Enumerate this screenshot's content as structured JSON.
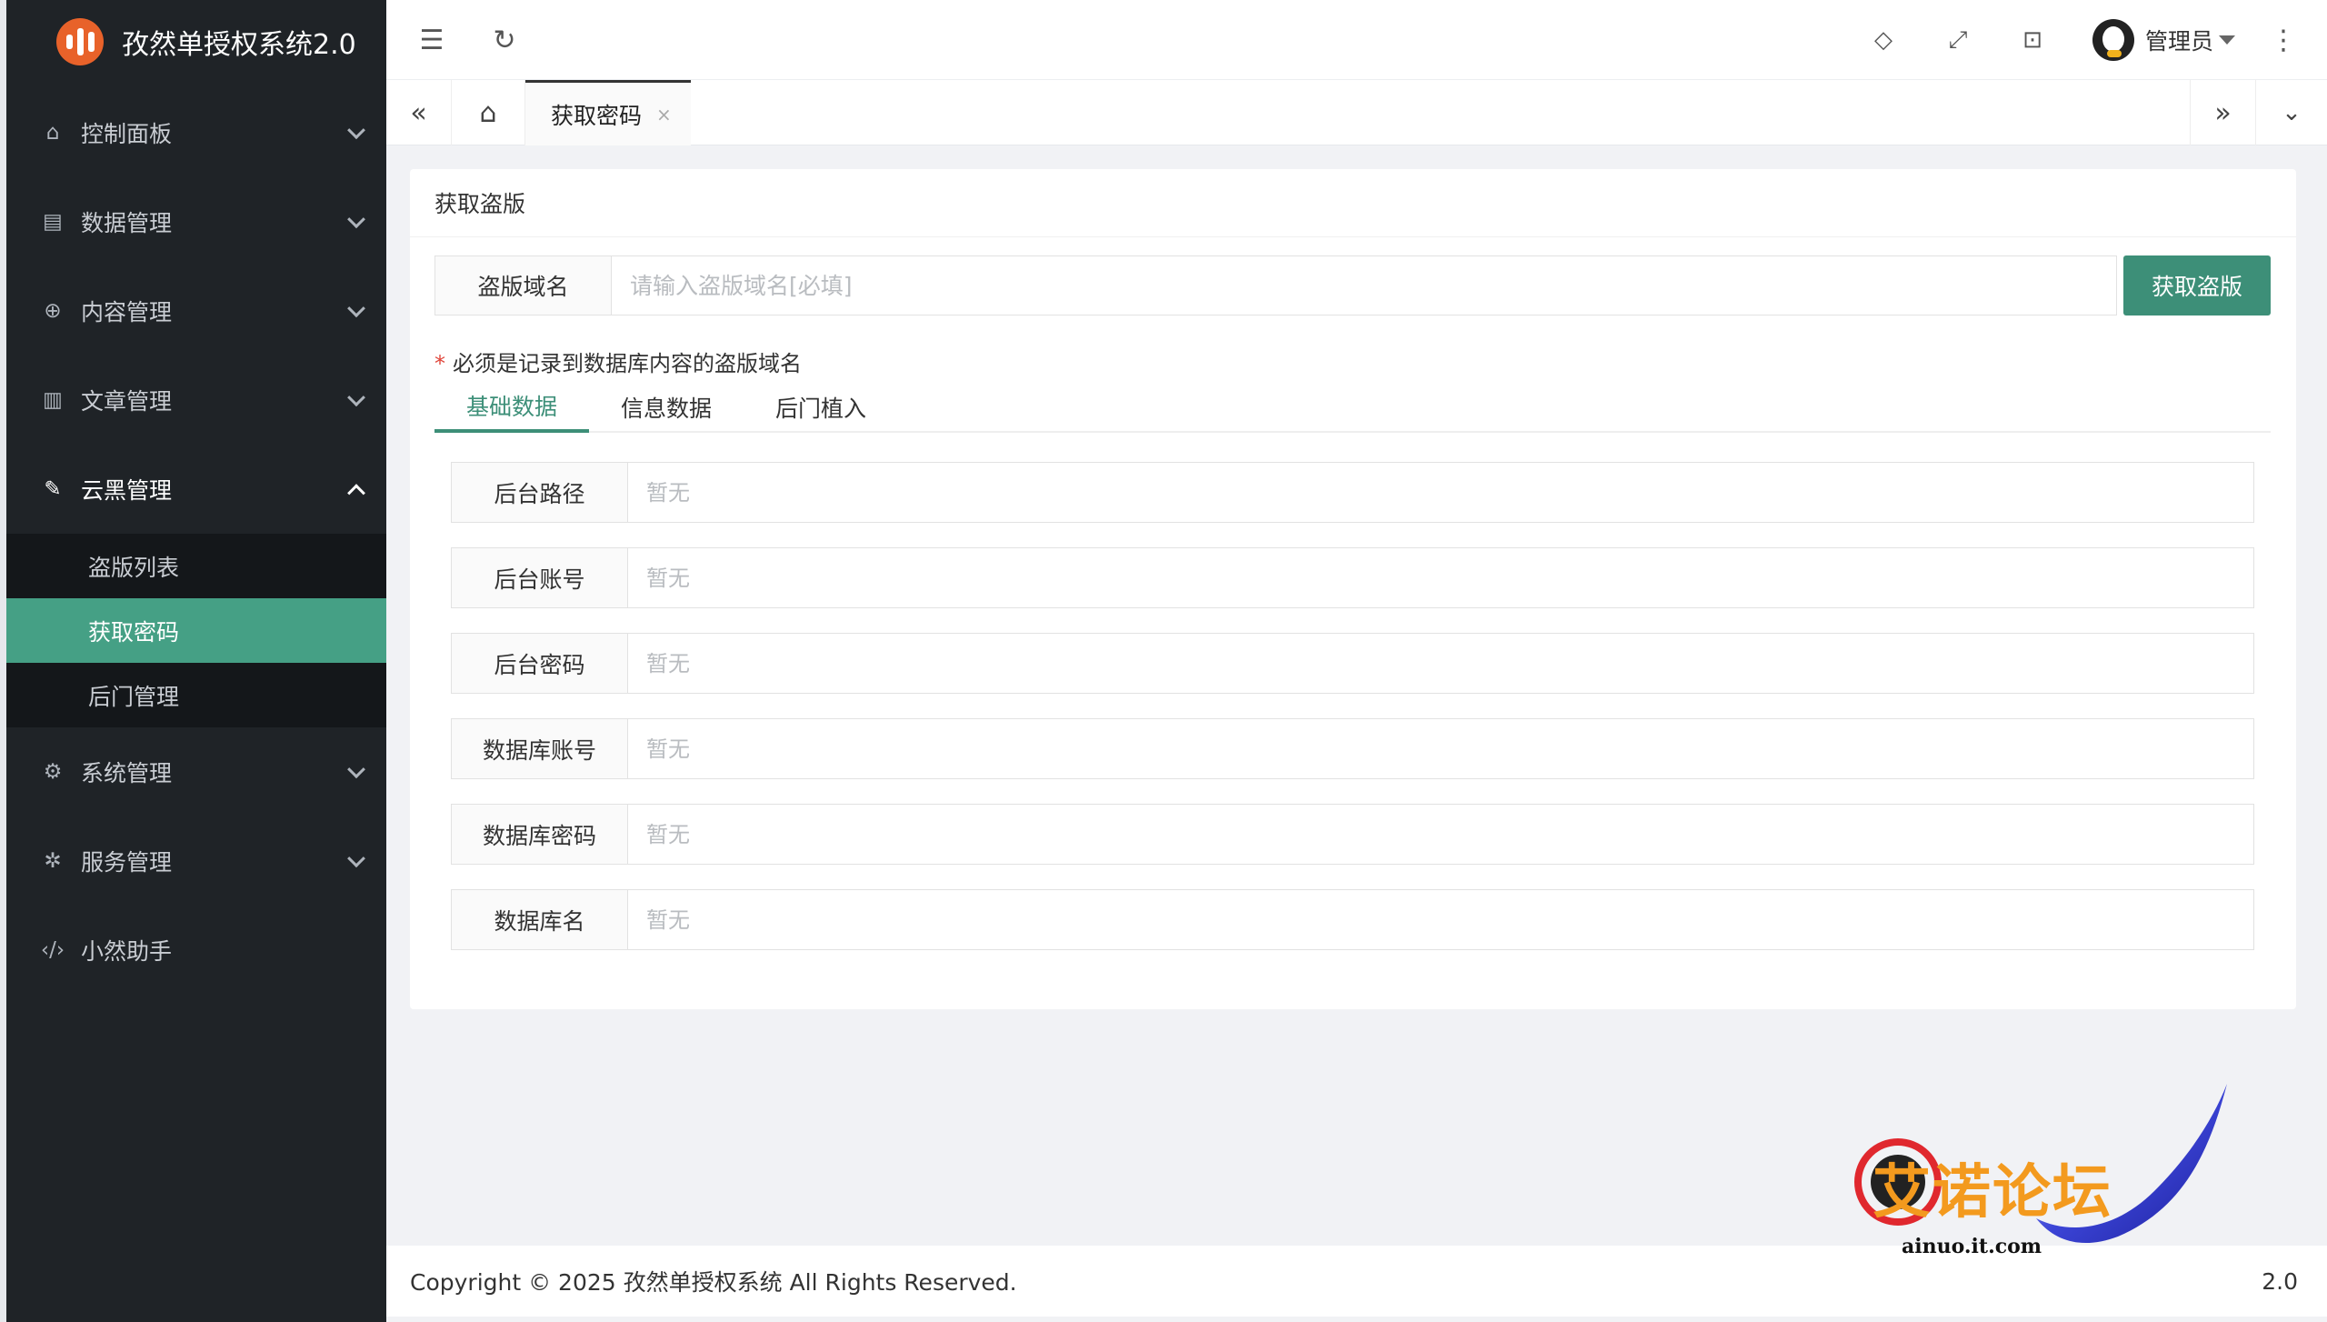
{
  "app": {
    "title": "孜然单授权系统2.0"
  },
  "sidebar": {
    "items": [
      {
        "label": "控制面板",
        "icon": "home-icon"
      },
      {
        "label": "数据管理",
        "icon": "document-icon"
      },
      {
        "label": "内容管理",
        "icon": "globe-icon"
      },
      {
        "label": "文章管理",
        "icon": "book-icon"
      },
      {
        "label": "云黑管理",
        "icon": "broom-icon",
        "expanded": true,
        "children": [
          {
            "label": "盗版列表"
          },
          {
            "label": "获取密码",
            "active": true
          },
          {
            "label": "后门管理"
          }
        ]
      },
      {
        "label": "系统管理",
        "icon": "gear-icon"
      },
      {
        "label": "服务管理",
        "icon": "service-icon"
      },
      {
        "label": "小然助手",
        "icon": "code-icon"
      }
    ]
  },
  "header": {
    "user": "管理员"
  },
  "tabs": {
    "active": "获取密码",
    "close": "×"
  },
  "card": {
    "title": "获取盗版",
    "domain_label": "盗版域名",
    "domain_placeholder": "请输入盗版域名[必填]",
    "submit": "获取盗版",
    "hint_star": "*",
    "hint": "必须是记录到数据库内容的盗版域名",
    "tabs": [
      "基础数据",
      "信息数据",
      "后门植入"
    ],
    "fields": [
      {
        "label": "后台路径",
        "placeholder": "暂无"
      },
      {
        "label": "后台账号",
        "placeholder": "暂无"
      },
      {
        "label": "后台密码",
        "placeholder": "暂无"
      },
      {
        "label": "数据库账号",
        "placeholder": "暂无"
      },
      {
        "label": "数据库密码",
        "placeholder": "暂无"
      },
      {
        "label": "数据库名",
        "placeholder": "暂无"
      }
    ]
  },
  "footer": {
    "copyright": "Copyright © 2025 孜然单授权系统 All Rights Reserved.",
    "version": "2.0"
  },
  "watermark": {
    "text": "艾诺论坛",
    "url": "ainuo.it.com"
  },
  "colors": {
    "accent": "#3d8f78",
    "sidebar_bg": "#1f2327",
    "active_item": "#45a085"
  }
}
